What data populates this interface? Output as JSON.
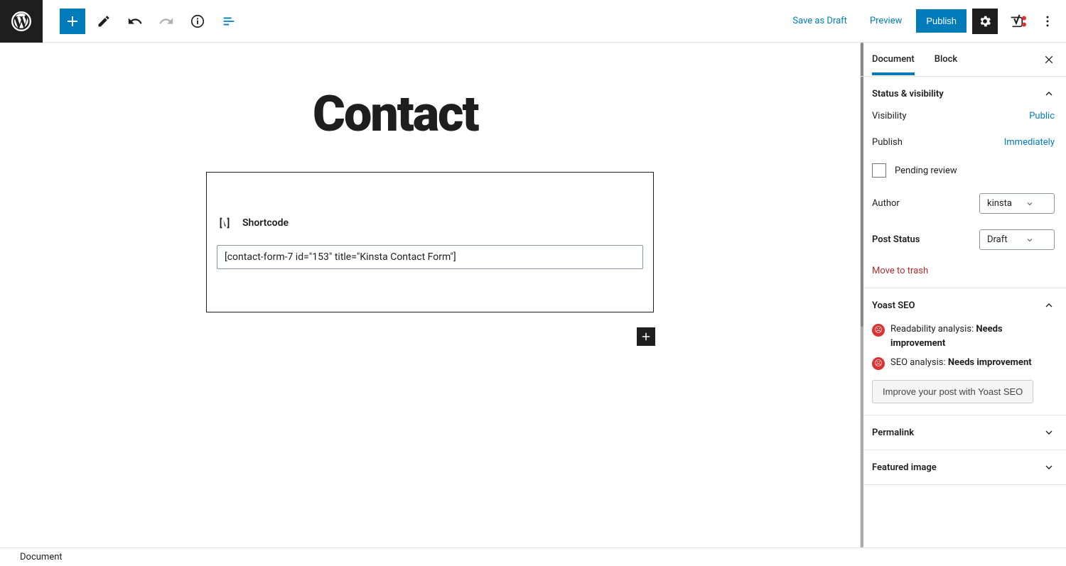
{
  "toolbar": {
    "save_draft": "Save as Draft",
    "preview": "Preview",
    "publish": "Publish"
  },
  "editor": {
    "title": "Contact",
    "block_label": "Shortcode",
    "shortcode_value": "[contact-form-7 id=\"153\" title=\"Kinsta Contact Form\"]"
  },
  "sidebar": {
    "tabs": {
      "document": "Document",
      "block": "Block"
    },
    "status": {
      "header": "Status & visibility",
      "visibility_label": "Visibility",
      "visibility_value": "Public",
      "publish_label": "Publish",
      "publish_value": "Immediately",
      "pending_label": "Pending review",
      "author_label": "Author",
      "author_value": "kinsta",
      "post_status_label": "Post Status",
      "post_status_value": "Draft",
      "trash": "Move to trash"
    },
    "yoast": {
      "header": "Yoast SEO",
      "readability_label": "Readability analysis: ",
      "readability_value": "Needs improvement",
      "seo_label": "SEO analysis: ",
      "seo_value": "Needs improvement",
      "improve_btn": "Improve your post with Yoast SEO"
    },
    "permalink_header": "Permalink",
    "featured_header": "Featured image"
  },
  "footer": {
    "breadcrumb": "Document"
  }
}
